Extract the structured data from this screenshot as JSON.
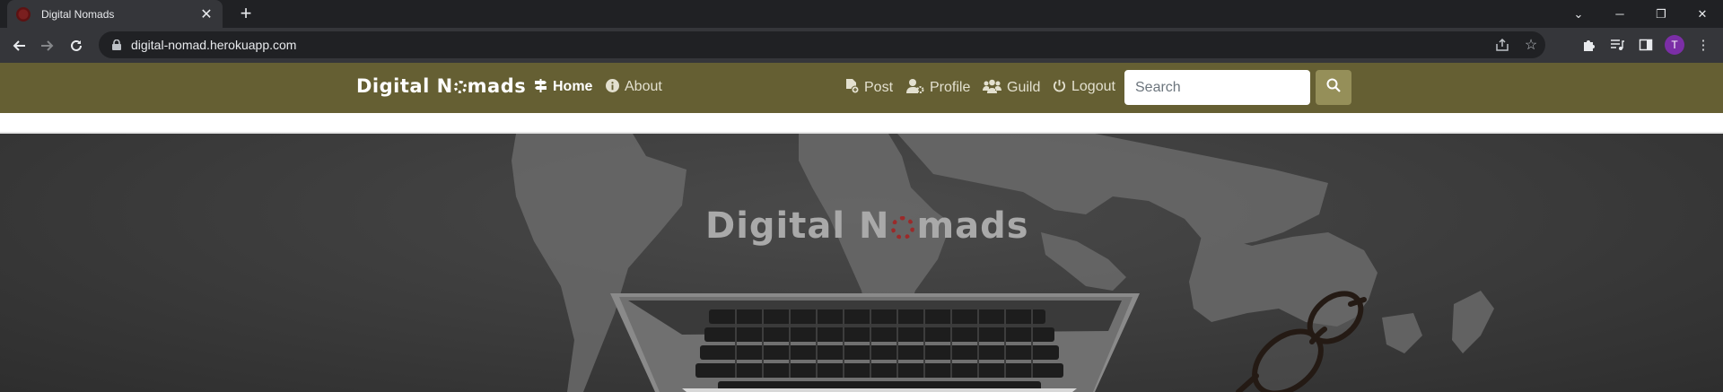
{
  "browser": {
    "tab": {
      "title": "Digital Nomads"
    },
    "url": "digital-nomad.herokuapp.com",
    "profile_initial": "T"
  },
  "site": {
    "brand": {
      "part1": "Digital N",
      "part2": "mads"
    },
    "nav": {
      "home": "Home",
      "about": "About",
      "post": "Post",
      "profile": "Profile",
      "guild": "Guild",
      "logout": "Logout"
    },
    "search": {
      "placeholder": "Search"
    }
  },
  "hero": {
    "title": {
      "part1": "Digital N",
      "part2": "mads"
    }
  },
  "colors": {
    "navbar": "#655f33",
    "search_button": "#958f59",
    "hero_gear": "#9b2a2a"
  }
}
